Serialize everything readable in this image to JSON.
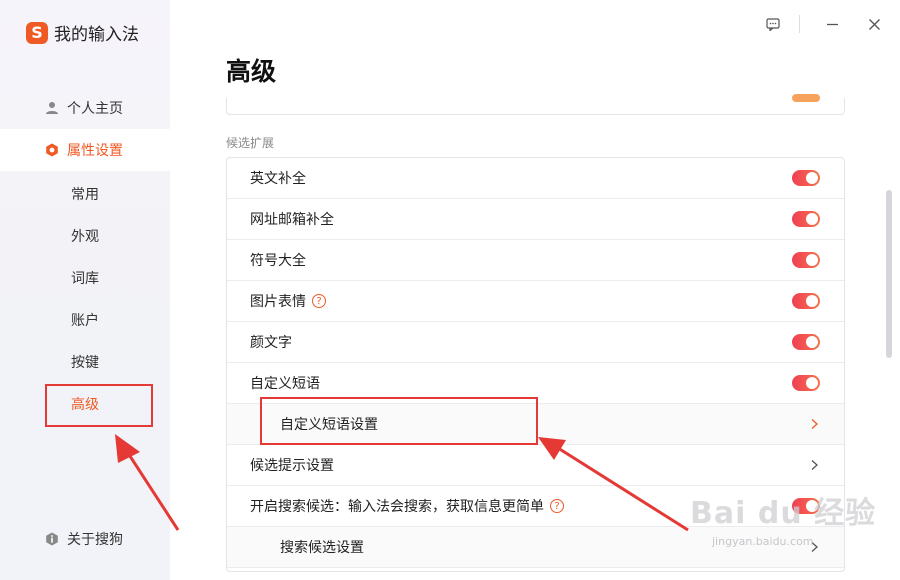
{
  "app": {
    "title": "我的输入法",
    "logo_letter": "S"
  },
  "sidebar": {
    "profile": "个人主页",
    "attributes": "属性设置",
    "sub_items": [
      "常用",
      "外观",
      "词库",
      "账户",
      "按键",
      "高级"
    ],
    "active_sub": "高级",
    "about": "关于搜狗"
  },
  "main": {
    "title": "高级",
    "section_label": "候选扩展",
    "rows": [
      {
        "label": "英文补全",
        "control": "toggle",
        "on": true
      },
      {
        "label": "网址邮箱补全",
        "control": "toggle",
        "on": true
      },
      {
        "label": "符号大全",
        "control": "toggle",
        "on": true
      },
      {
        "label": "图片表情",
        "control": "toggle",
        "on": true,
        "help": true
      },
      {
        "label": "颜文字",
        "control": "toggle",
        "on": true
      },
      {
        "label": "自定义短语",
        "control": "toggle",
        "on": true
      },
      {
        "label": "自定义短语设置",
        "control": "chevron",
        "indent": true
      },
      {
        "label": "候选提示设置",
        "control": "chevron"
      },
      {
        "label": "开启搜索候选：输入法会搜索，获取信息更简单",
        "control": "toggle",
        "on": true,
        "help": true
      },
      {
        "label": "搜索候选设置",
        "control": "chevron",
        "indent": true
      }
    ]
  },
  "colors": {
    "accent": "#ef5a24",
    "toggle_start": "#ef3f55",
    "toggle_end": "#f7724a",
    "annotation": "#e53935"
  },
  "icons": [
    "feedback-icon",
    "minimize-icon",
    "close-icon",
    "user-icon",
    "settings-hex-icon",
    "info-icon",
    "help-icon",
    "chevron-right-icon"
  ],
  "watermark": {
    "main": "Bai du 经验",
    "sub": "jingyan.baidu.com"
  }
}
